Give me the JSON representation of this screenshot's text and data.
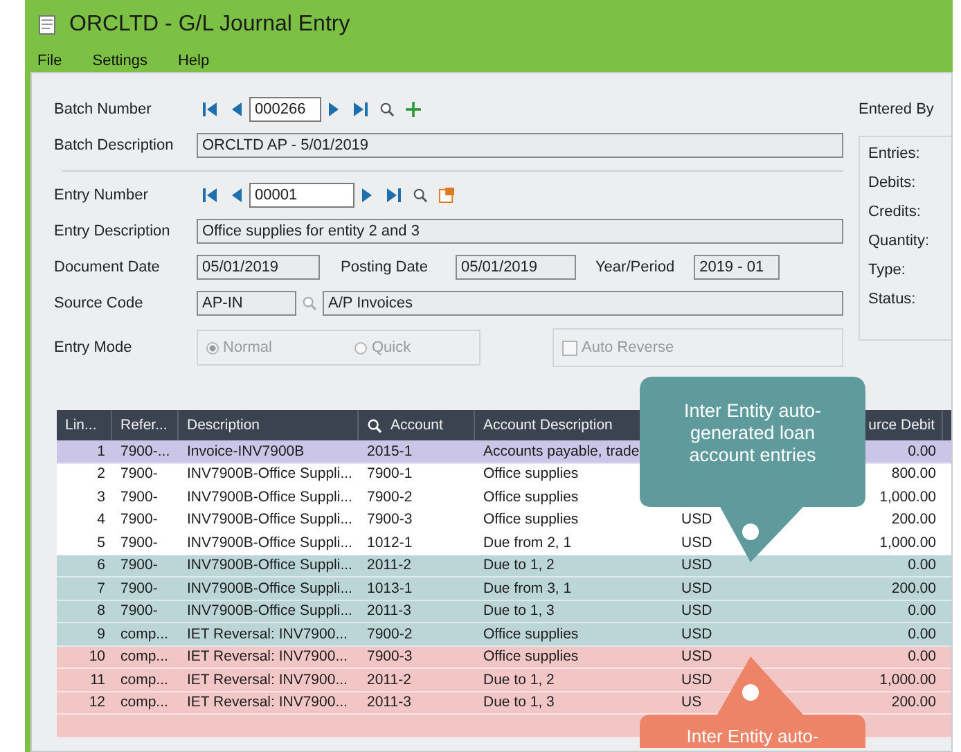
{
  "window": {
    "title": "ORCLTD - G/L Journal Entry"
  },
  "menu": [
    "File",
    "Settings",
    "Help"
  ],
  "form": {
    "batch_number": {
      "label": "Batch Number",
      "value": "000266"
    },
    "batch_description": {
      "label": "Batch Description",
      "value": "ORCLTD AP -  5/01/2019"
    },
    "entry_number": {
      "label": "Entry Number",
      "value": "00001"
    },
    "entry_description": {
      "label": "Entry Description",
      "value": "Office supplies for entity 2 and 3"
    },
    "document_date": {
      "label": "Document Date",
      "value": "05/01/2019"
    },
    "posting_date": {
      "label": "Posting Date",
      "value": "05/01/2019"
    },
    "year_period": {
      "label": "Year/Period",
      "value": "2019 - 01"
    },
    "source_code": {
      "label": "Source Code",
      "value": "AP-IN",
      "description": "A/P Invoices"
    },
    "entry_mode": {
      "label": "Entry Mode",
      "options": [
        {
          "label": "Normal",
          "selected": true
        },
        {
          "label": "Quick",
          "selected": false
        }
      ]
    },
    "auto_reverse": {
      "label": "Auto Reverse",
      "checked": false
    }
  },
  "summary": {
    "entered_by": "Entered By",
    "labels": [
      "Entries:",
      "Debits:",
      "Credits:",
      "Quantity:",
      "Type:",
      "Status:"
    ]
  },
  "table": {
    "columns": [
      {
        "label": "Lin..."
      },
      {
        "label": "Refer..."
      },
      {
        "label": "Description"
      },
      {
        "label": "Account",
        "kind": "search"
      },
      {
        "label": "Account Description"
      },
      {
        "label": "urce Debit"
      }
    ],
    "rows": [
      {
        "line": "1",
        "reference": "7900-...",
        "description": "Invoice-INV7900B",
        "account": "2015-1",
        "account_description": "Accounts payable, trade",
        "debit": "0.00",
        "color": "#cbc5e8"
      },
      {
        "line": "2",
        "reference": "7900-",
        "description": "INV7900B-Office Suppli...",
        "account": "7900-1",
        "account_description": "Office supplies",
        "debit": "800.00",
        "color": "#ffffff"
      },
      {
        "line": "3",
        "reference": "7900-",
        "description": "INV7900B-Office Suppli...",
        "account": "7900-2",
        "account_description": "Office supplies",
        "debit": "1,000.00",
        "color": "#ffffff"
      },
      {
        "line": "4",
        "reference": "7900-",
        "description": "INV7900B-Office Suppli...",
        "account": "7900-3",
        "account_description": "Office supplies",
        "currency": "USD",
        "debit": "200.00",
        "color": "#ffffff"
      },
      {
        "line": "5",
        "reference": "7900-",
        "description": "INV7900B-Office Suppli...",
        "account": "1012-1",
        "account_description": "Due from 2, 1",
        "currency": "USD",
        "debit": "1,000.00",
        "color": "#ffffff"
      },
      {
        "line": "6",
        "reference": "7900-",
        "description": "INV7900B-Office Suppli...",
        "account": "2011-2",
        "account_description": "Due to 1, 2",
        "currency": "USD",
        "debit": "0.00",
        "color": "#bcd6d8"
      },
      {
        "line": "7",
        "reference": "7900-",
        "description": "INV7900B-Office Suppli...",
        "account": "1013-1",
        "account_description": "Due from 3, 1",
        "currency": "USD",
        "debit": "200.00",
        "color": "#bcd6d8"
      },
      {
        "line": "8",
        "reference": "7900-",
        "description": "INV7900B-Office Suppli...",
        "account": "2011-3",
        "account_description": "Due to 1, 3",
        "currency": "USD",
        "debit": "0.00",
        "color": "#bcd6d8"
      },
      {
        "line": "9",
        "reference": "comp...",
        "description": "IET Reversal: INV7900...",
        "account": "7900-2",
        "account_description": "Office supplies",
        "currency": "USD",
        "debit": "0.00",
        "color": "#bcd6d8"
      },
      {
        "line": "10",
        "reference": "comp...",
        "description": "IET Reversal: INV7900...",
        "account": "7900-3",
        "account_description": "Office supplies",
        "currency": "USD",
        "debit": "0.00",
        "color": "#f3c6c6"
      },
      {
        "line": "11",
        "reference": "comp...",
        "description": "IET Reversal: INV7900...",
        "account": "2011-2",
        "account_description": "Due to 1, 2",
        "currency": "USD",
        "debit": "1,000.00",
        "color": "#f3c6c6"
      },
      {
        "line": "12",
        "reference": "comp...",
        "description": "IET Reversal: INV7900...",
        "account": "2011-3",
        "account_description": "Due to 1, 3",
        "currency": "US",
        "debit": "200.00",
        "color": "#f3c6c6"
      }
    ]
  },
  "callouts": [
    {
      "kind": "down",
      "text": "Inter Entity auto-generated loan account entries"
    },
    {
      "kind": "up",
      "text": "Inter Entity auto-"
    }
  ]
}
